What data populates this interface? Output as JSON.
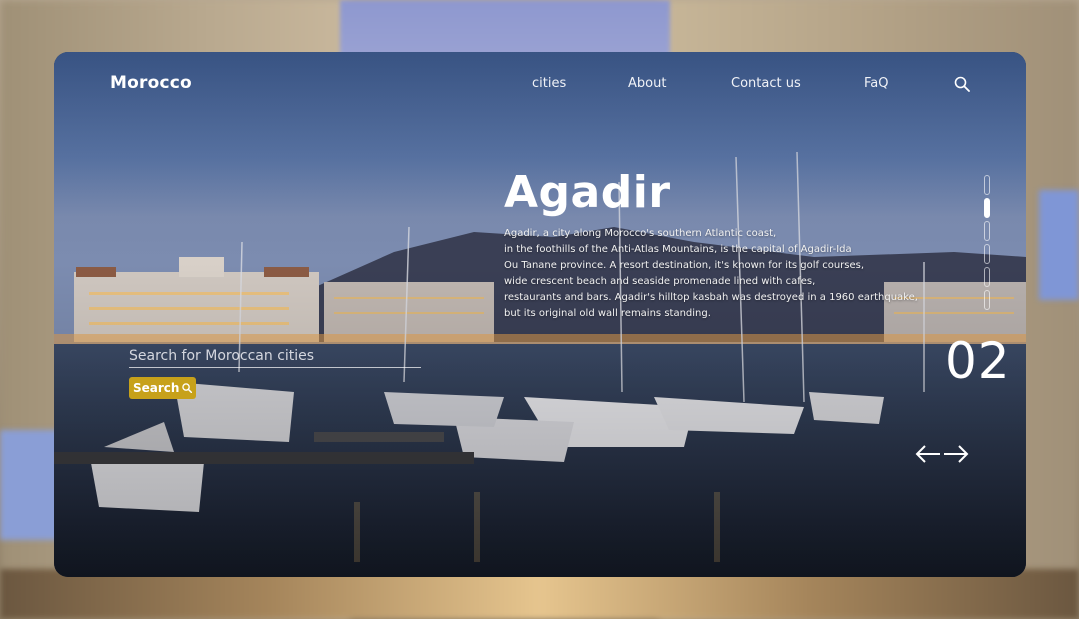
{
  "header": {
    "logo": "Morocco",
    "nav": [
      "cities",
      "About",
      "Contact us",
      "FaQ"
    ]
  },
  "hero": {
    "title": "Agadir",
    "description_lines": [
      "Agadir, a city along Morocco's southern Atlantic coast,",
      "in the foothills of the Anti-Atlas Mountains, is the capital of Agadir-Ida",
      "Ou Tanane province. A resort destination, it's known for its golf courses,",
      "wide crescent beach and seaside promenade lined with cafes,",
      "restaurants and bars. Agadir's hilltop kasbah was destroyed in a 1960 earthquake,",
      "but its original old wall remains standing."
    ]
  },
  "search": {
    "placeholder": "Search for Moroccan cities",
    "button_label": "Search"
  },
  "slider": {
    "current": "02",
    "dot_count": 6,
    "active_index": 1
  },
  "icons": {
    "search": "search-icon",
    "prev": "arrow-left-icon",
    "next": "arrow-right-icon"
  },
  "colors": {
    "accent": "#c7a11a",
    "text": "#ffffff"
  }
}
